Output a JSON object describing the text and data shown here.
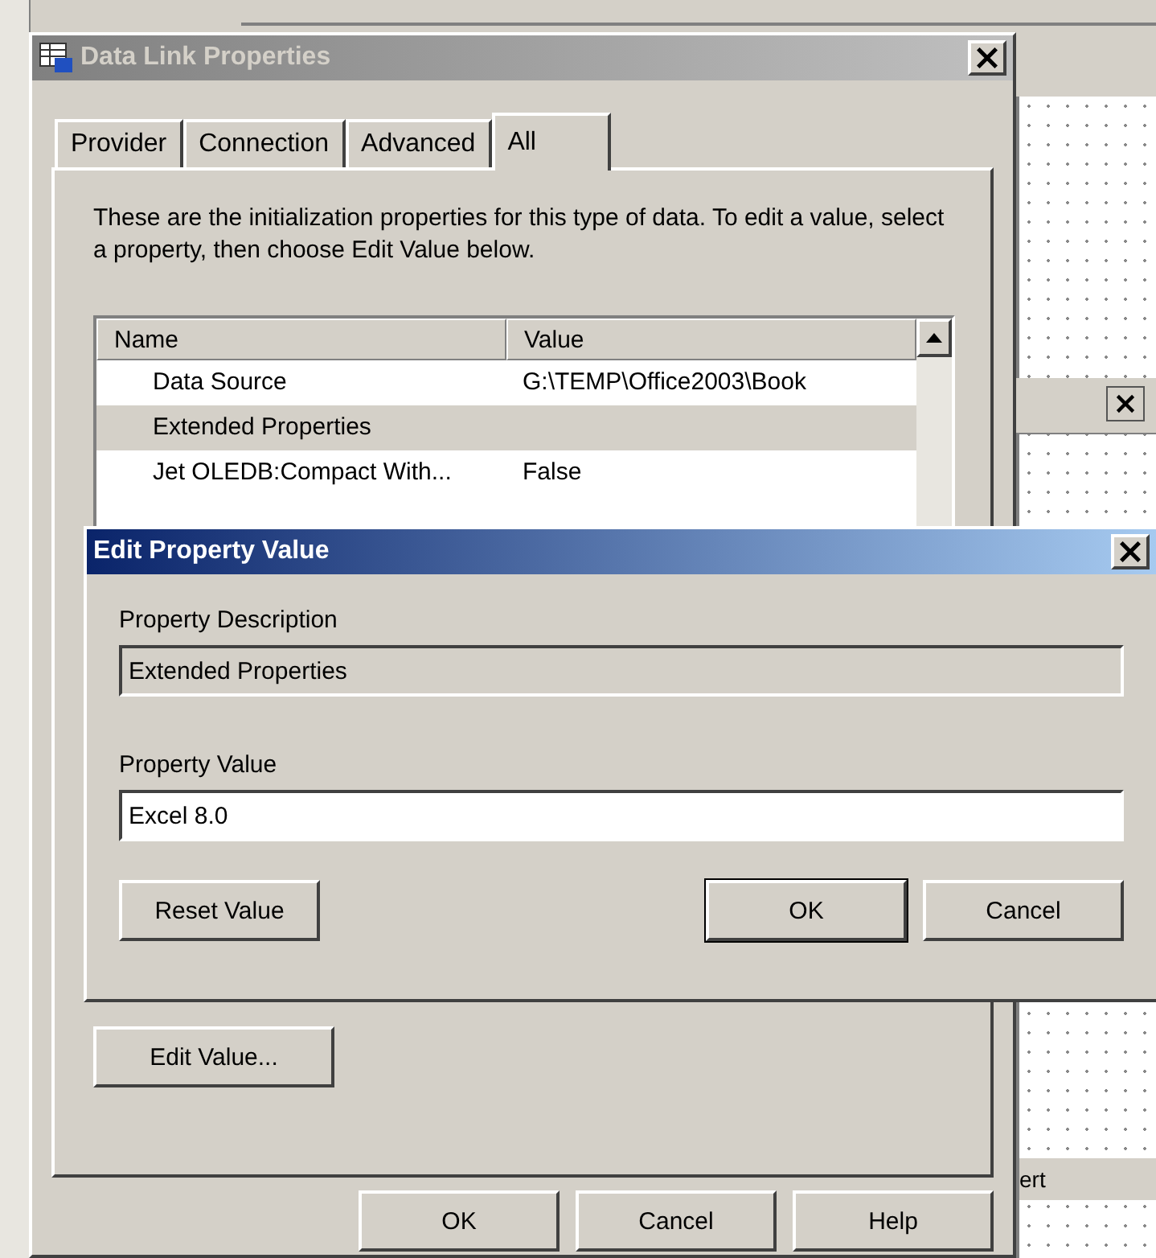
{
  "background": {
    "fragment": "ert"
  },
  "main_dialog": {
    "title": "Data Link Properties",
    "active": false,
    "tabs": [
      {
        "label": "Provider",
        "selected": false
      },
      {
        "label": "Connection",
        "selected": false
      },
      {
        "label": "Advanced",
        "selected": false
      },
      {
        "label": "All",
        "selected": true
      }
    ],
    "description": "These are the initialization properties for this type of data. To edit a value, select a property, then choose Edit Value below.",
    "list": {
      "columns": [
        "Name",
        "Value"
      ],
      "rows": [
        {
          "name": "Data Source",
          "value": "G:\\TEMP\\Office2003\\Book",
          "selected": false
        },
        {
          "name": "Extended Properties",
          "selected": true
        },
        {
          "name": "Jet OLEDB:Compact With...",
          "value": "False",
          "selected": false
        }
      ]
    },
    "edit_button": "Edit Value...",
    "buttons": [
      "OK",
      "Cancel",
      "Help"
    ]
  },
  "edit_dialog": {
    "title": "Edit Property Value",
    "active": true,
    "description_label": "Property Description",
    "description_value": "Extended Properties",
    "value_label": "Property Value",
    "value": "Excel 8.0",
    "buttons": [
      {
        "label": "Reset Value",
        "default": false
      },
      {
        "label": "OK",
        "default": true
      },
      {
        "label": "Cancel",
        "default": false
      }
    ]
  }
}
